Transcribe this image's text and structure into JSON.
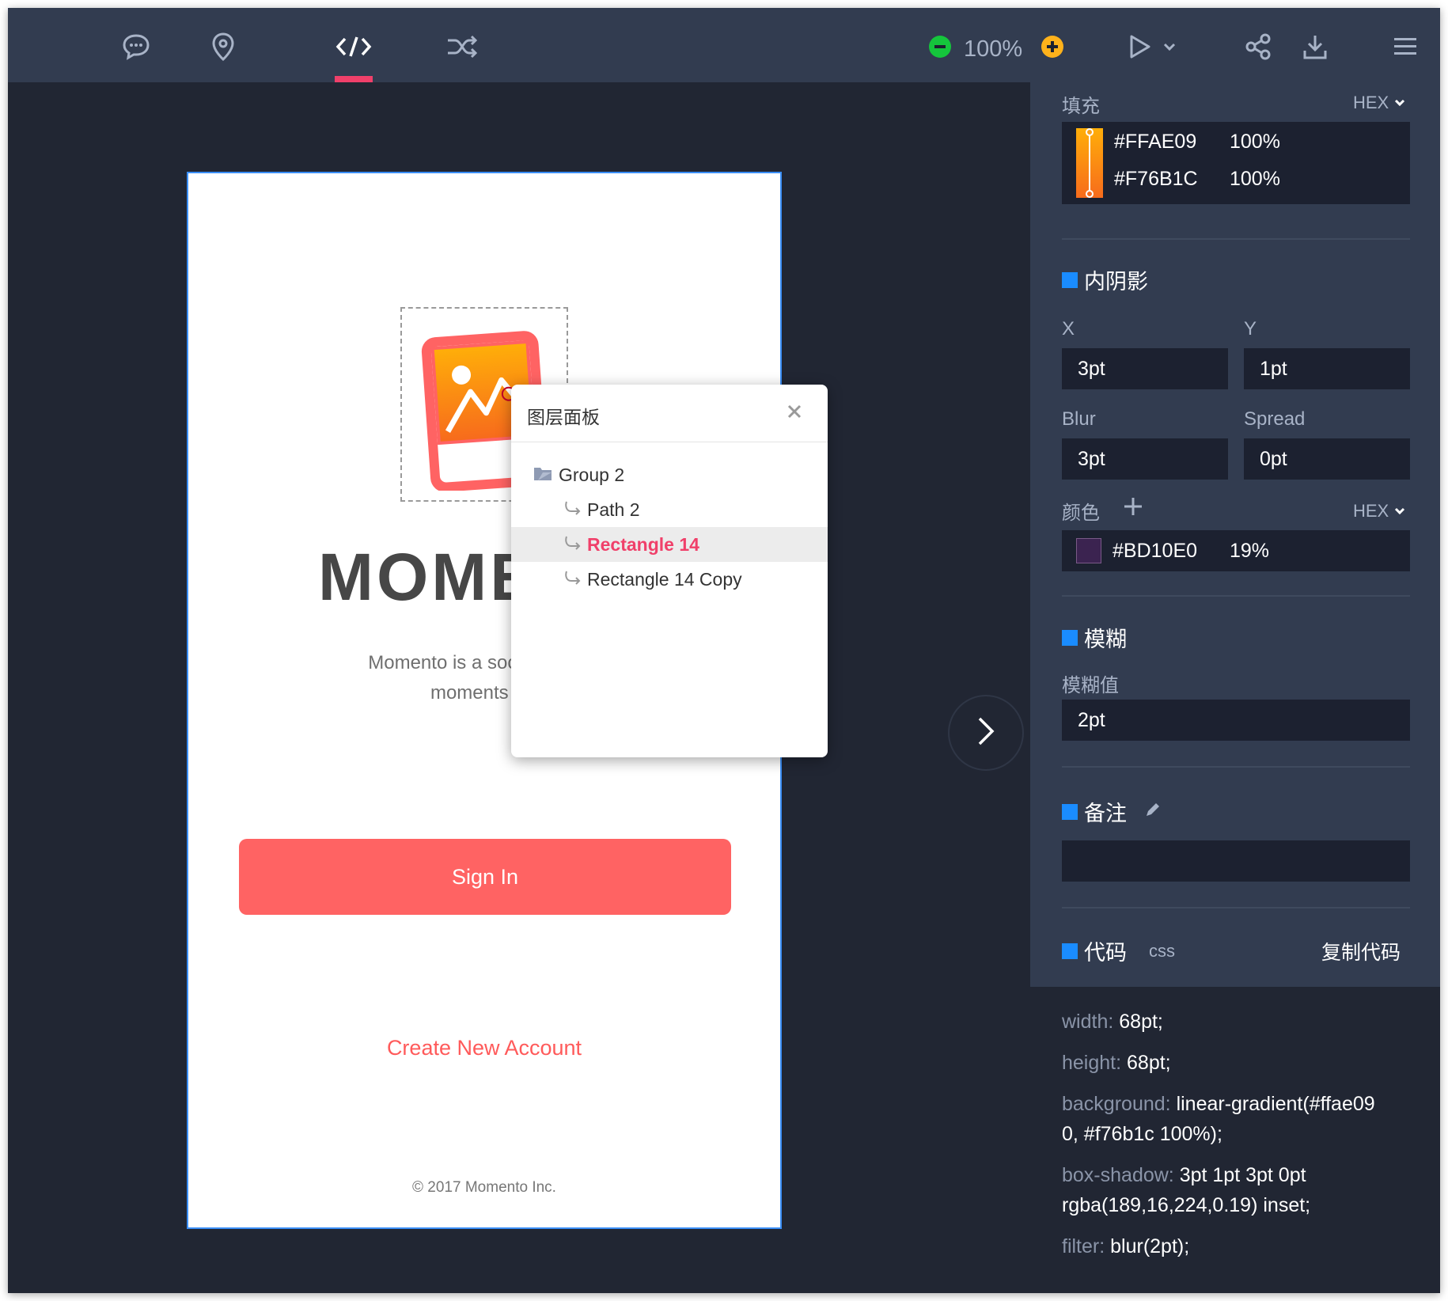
{
  "toolbar": {
    "icons": [
      "comment-icon",
      "location-pin-icon",
      "code-icon",
      "shuffle-icon"
    ],
    "zoom": "100%",
    "right_icons": [
      "play-icon",
      "share-icon",
      "download-icon",
      "menu-icon"
    ],
    "colors": {
      "zoom_out": "#15c53c",
      "zoom_in": "#ffb21b",
      "active_tab": "#f0406a"
    }
  },
  "artboard": {
    "brand_title": "MOMENTO",
    "description_line1": "Momento is a social app that",
    "description_line2": "moments with",
    "sign_in": "Sign In",
    "create_account": "Create New Account",
    "copyright": "© 2017 Momento Inc."
  },
  "layer_panel": {
    "title": "图层面板",
    "items": [
      {
        "label": "Group 2",
        "icon": "folder-icon"
      },
      {
        "label": "Path 2",
        "icon": "path-icon"
      },
      {
        "label": "Rectangle 14",
        "icon": "path-icon",
        "selected": true
      },
      {
        "label": "Rectangle 14 Copy",
        "icon": "path-icon"
      }
    ]
  },
  "inspector": {
    "fill": {
      "label": "填充",
      "mode": "HEX",
      "stops": [
        {
          "hex": "#FFAE09",
          "opacity": "100%"
        },
        {
          "hex": "#F76B1C",
          "opacity": "100%"
        }
      ]
    },
    "inner_shadow": {
      "title": "内阴影",
      "x_label": "X",
      "x": "3pt",
      "y_label": "Y",
      "y": "1pt",
      "blur_label": "Blur",
      "blur": "3pt",
      "spread_label": "Spread",
      "spread": "0pt",
      "color_label": "颜色",
      "mode": "HEX",
      "color_hex": "#BD10E0",
      "color_opacity": "19%",
      "swatch": "#3b2350"
    },
    "blur": {
      "title": "模糊",
      "value_label": "模糊值",
      "value": "2pt"
    },
    "notes": {
      "title": "备注",
      "value": ""
    },
    "code": {
      "title": "代码",
      "lang": "css",
      "copy_label": "复制代码",
      "lines": [
        {
          "key": "width:",
          "val": "68pt;"
        },
        {
          "key": "height:",
          "val": "68pt;"
        },
        {
          "key": "background:",
          "val": "linear-gradient(#ffae09"
        },
        {
          "key": "",
          "val": "0, #f76b1c 100%);"
        },
        {
          "key": "box-shadow:",
          "val": "3pt 1pt 3pt 0pt"
        },
        {
          "key": "",
          "val": "rgba(189,16,224,0.19) inset;"
        },
        {
          "key": "filter:",
          "val": "blur(2pt);"
        }
      ]
    }
  }
}
